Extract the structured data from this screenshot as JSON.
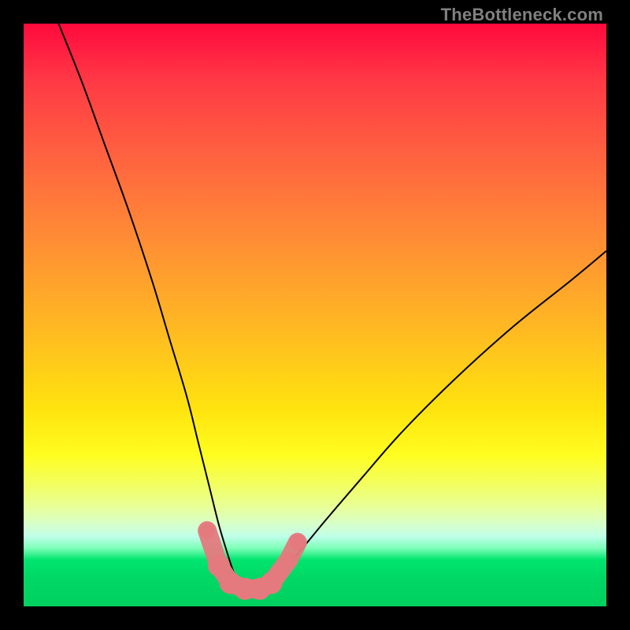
{
  "watermark": "TheBottleneck.com",
  "chart_data": {
    "type": "line",
    "title": "",
    "xlabel": "",
    "ylabel": "",
    "xlim": [
      0,
      100
    ],
    "ylim": [
      0,
      100
    ],
    "series": [
      {
        "name": "bottleneck-curve",
        "x": [
          6,
          10,
          14,
          18,
          22,
          25,
          28,
          30,
          32,
          33.5,
          35,
          36,
          37,
          38.5,
          40,
          42,
          44,
          47,
          52,
          58,
          65,
          74,
          84,
          94,
          100
        ],
        "y": [
          100,
          90,
          79,
          68,
          56,
          46,
          36,
          28,
          20,
          14,
          9,
          6,
          4,
          3,
          3,
          4,
          6,
          9,
          15,
          22,
          30,
          39,
          48,
          56,
          61
        ]
      }
    ],
    "markers": {
      "name": "highlight-points",
      "color": "#e47a7e",
      "x": [
        31.5,
        33.5,
        35.5,
        38,
        40.5,
        42.5,
        44,
        45.5,
        47
      ],
      "y": [
        13,
        7,
        4,
        3,
        3,
        4,
        6,
        8,
        11
      ],
      "size": [
        10,
        14,
        14,
        14,
        14,
        14,
        10,
        10,
        10
      ]
    },
    "gradient_stops": [
      {
        "pct": 0,
        "color": "#ff0a3c"
      },
      {
        "pct": 22,
        "color": "#ff6040"
      },
      {
        "pct": 52,
        "color": "#ffb823"
      },
      {
        "pct": 74,
        "color": "#fffd20"
      },
      {
        "pct": 92,
        "color": "#00e56f"
      },
      {
        "pct": 100,
        "color": "#00d05f"
      }
    ]
  }
}
